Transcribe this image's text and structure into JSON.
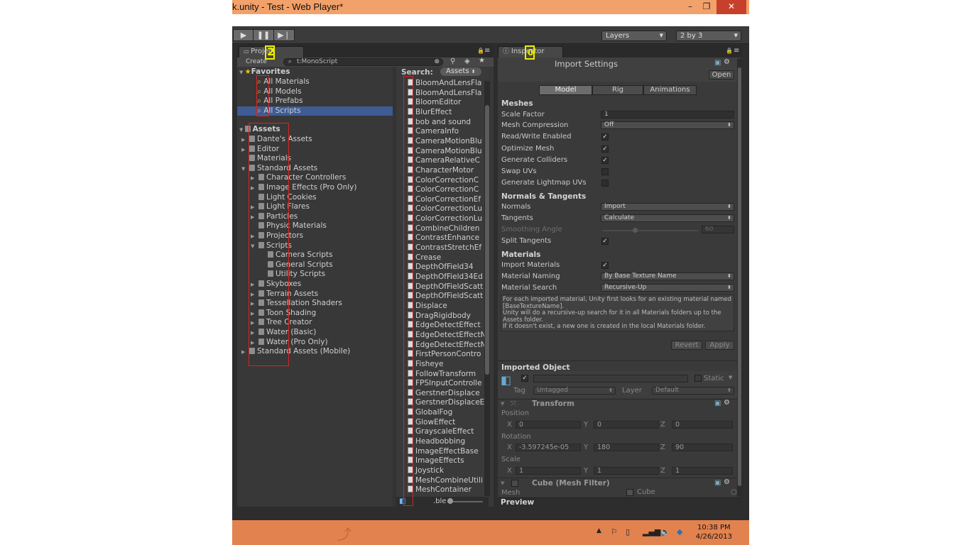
{
  "window": {
    "title": "k.unity - Test - Web Player*",
    "minimize": "–",
    "restore": "❐",
    "close": "✕"
  },
  "toolbar": {
    "play": "▶",
    "pause": "❚❚",
    "step": "▶❘",
    "layers": "Layers",
    "layout": "2 by 3"
  },
  "project": {
    "tab": "Project",
    "create": "Create",
    "search_value": "t:MonoScript",
    "search_label": "Search:",
    "scope": "Assets",
    "favorites_label": "Favorites",
    "favorites": [
      "All Materials",
      "All Models",
      "All Prefabs",
      "All Scripts"
    ],
    "assets_label": "Assets",
    "tree": [
      {
        "label": "Dante's Assets",
        "indent": 1,
        "arrow": "▶"
      },
      {
        "label": "Editor",
        "indent": 1,
        "arrow": "▶"
      },
      {
        "label": "Materials",
        "indent": 1,
        "arrow": ""
      },
      {
        "label": "Standard Assets",
        "indent": 1,
        "arrow": "▼"
      },
      {
        "label": "Character Controllers",
        "indent": 2,
        "arrow": "▶"
      },
      {
        "label": "Image Effects (Pro Only)",
        "indent": 2,
        "arrow": "▶"
      },
      {
        "label": "Light Cookies",
        "indent": 2,
        "arrow": ""
      },
      {
        "label": "Light Flares",
        "indent": 2,
        "arrow": "▶"
      },
      {
        "label": "Particles",
        "indent": 2,
        "arrow": "▶"
      },
      {
        "label": "Physic Materials",
        "indent": 2,
        "arrow": ""
      },
      {
        "label": "Projectors",
        "indent": 2,
        "arrow": "▶"
      },
      {
        "label": "Scripts",
        "indent": 2,
        "arrow": "▼"
      },
      {
        "label": "Camera Scripts",
        "indent": 3,
        "arrow": ""
      },
      {
        "label": "General Scripts",
        "indent": 3,
        "arrow": ""
      },
      {
        "label": "Utility Scripts",
        "indent": 3,
        "arrow": ""
      },
      {
        "label": "Skyboxes",
        "indent": 2,
        "arrow": "▶"
      },
      {
        "label": "Terrain Assets",
        "indent": 2,
        "arrow": "▶"
      },
      {
        "label": "Tessellation Shaders",
        "indent": 2,
        "arrow": "▶"
      },
      {
        "label": "Toon Shading",
        "indent": 2,
        "arrow": "▶"
      },
      {
        "label": "Tree Creator",
        "indent": 2,
        "arrow": "▶"
      },
      {
        "label": "Water (Basic)",
        "indent": 2,
        "arrow": "▶"
      },
      {
        "label": "Water (Pro Only)",
        "indent": 2,
        "arrow": "▶"
      },
      {
        "label": "Standard Assets (Mobile)",
        "indent": 1,
        "arrow": "▶"
      }
    ],
    "scripts": [
      "BloomAndLensFla",
      "BloomAndLensFla",
      "BloomEditor",
      "BlurEffect",
      "bob and sound",
      "CameraInfo",
      "CameraMotionBlu",
      "CameraMotionBlu",
      "CameraRelativeC",
      "CharacterMotor",
      "ColorCorrectionC",
      "ColorCorrectionC",
      "ColorCorrectionEf",
      "ColorCorrectionLu",
      "ColorCorrectionLu",
      "CombineChildren",
      "ContrastEnhance",
      "ContrastStretchEf",
      "Crease",
      "DepthOfField34",
      "DepthOfField34Ed",
      "DepthOfFieldScatt",
      "DepthOfFieldScatt",
      "Displace",
      "DragRigidbody",
      "EdgeDetectEffect",
      "EdgeDetectEffectN",
      "EdgeDetectEffectN",
      "FirstPersonContro",
      "Fisheye",
      "FollowTransform",
      "FPSInputControlle",
      "GerstnerDisplace",
      "GerstnerDisplaceE",
      "GlobalFog",
      "GlowEffect",
      "GrayscaleEffect",
      "Headbobbing",
      "ImageEffectBase",
      "ImageEffects",
      "Joystick",
      "MeshCombineUtili",
      "MeshContainer"
    ],
    "footer_text": ".ble"
  },
  "inspector": {
    "tab": "Inspector",
    "title": "Import Settings",
    "open": "Open",
    "tabs": [
      "Model",
      "Rig",
      "Animations"
    ],
    "meshes": "Meshes",
    "scale_factor_label": "Scale Factor",
    "scale_factor": "1",
    "mesh_compression_label": "Mesh Compression",
    "mesh_compression": "Off",
    "rw_label": "Read/Write Enabled",
    "optimize_label": "Optimize Mesh",
    "colliders_label": "Generate Colliders",
    "swap_label": "Swap UVs",
    "lightmap_label": "Generate Lightmap UVs",
    "normals_tangents": "Normals & Tangents",
    "normals_label": "Normals",
    "normals": "Import",
    "tangents_label": "Tangents",
    "tangents": "Calculate",
    "smoothing_label": "Smoothing Angle",
    "smoothing": "60",
    "split_label": "Split Tangents",
    "materials": "Materials",
    "import_mat_label": "Import Materials",
    "naming_label": "Material Naming",
    "naming": "By Base Texture Name",
    "search_label": "Material Search",
    "search": "Recursive-Up",
    "help": "For each imported material, Unity first looks for an existing material named [BaseTextureName].\nUnity will do a recursive-up search for it in all Materials folders up to the Assets folder.\nIf it doesn't exist, a new one is created in the local Materials folder.",
    "revert": "Revert",
    "apply": "Apply",
    "imported_object": "Imported Object",
    "static": "Static",
    "tag_label": "Tag",
    "tag": "Untagged",
    "layer_label": "Layer",
    "layer": "Default",
    "transform": "Transform",
    "position": "Position",
    "rotation": "Rotation",
    "scale": "Scale",
    "pos": [
      "0",
      "0",
      "0"
    ],
    "rot": [
      "-3.597245e-05",
      "180",
      "90"
    ],
    "scl": [
      "1",
      "1",
      "1"
    ],
    "mesh_filter": "Cube (Mesh Filter)",
    "mesh_label": "Mesh",
    "mesh": "Cube",
    "preview": "Preview"
  },
  "annotations": {
    "left": "2",
    "right": "0"
  },
  "taskbar": {
    "time": "10:38 PM",
    "date": "4/26/2013"
  },
  "colors": {
    "titlebar": "#f2a16a",
    "close": "#c7402b",
    "taskbar": "#e2824f",
    "selection": "#3d5c94",
    "highlight": "#dd2222",
    "marker": "#eeee00"
  }
}
